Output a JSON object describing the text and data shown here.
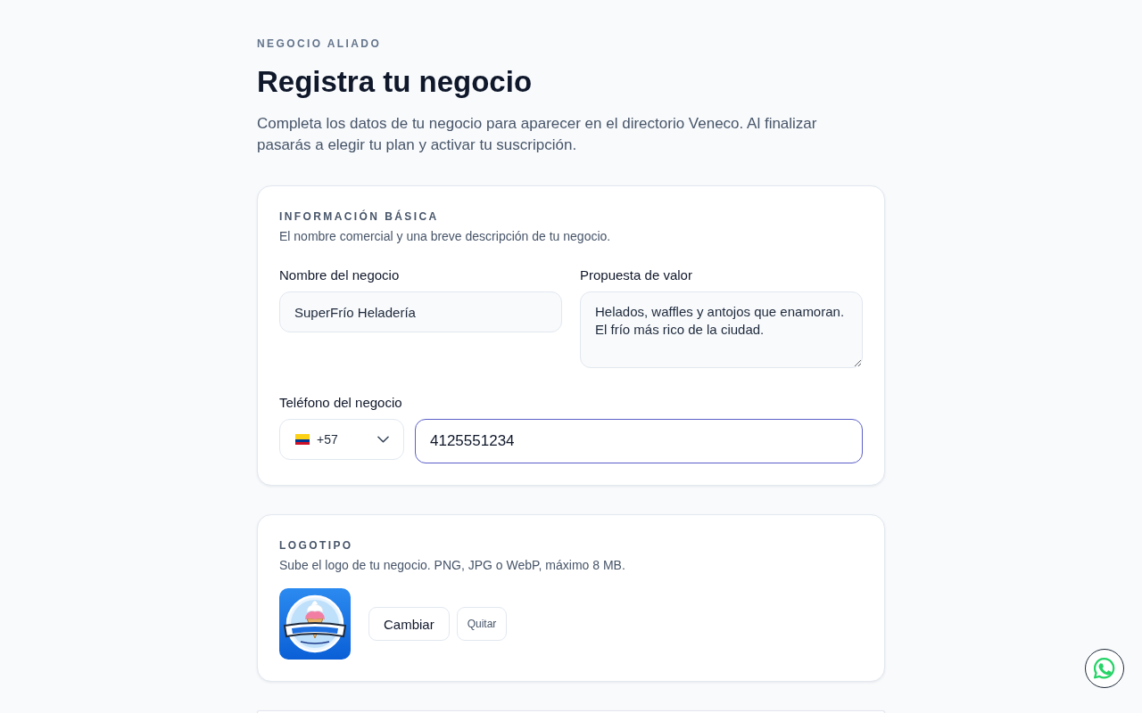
{
  "header": {
    "eyebrow": "NEGOCIO ALIADO",
    "title": "Registra tu negocio",
    "description": "Completa los datos de tu negocio para aparecer en el directorio Veneco. Al finalizar pasarás a elegir tu plan y activar tu suscripción."
  },
  "sections": [
    {
      "kind": "form",
      "title": "INFORMACIÓN BÁSICA",
      "subtitle": "El nombre comercial y una breve descripción de tu negocio.",
      "fields": [
        {
          "kind": "text",
          "label": "Nombre del negocio",
          "value": "SuperFrío Heladería",
          "focused": false
        },
        {
          "kind": "textarea",
          "label": "Propuesta de valor",
          "value": "Helados, waffles y antojos que enamoran. El frío más rico de la ciudad.",
          "focused": false
        },
        {
          "kind": "phone",
          "label": "Teléfono del negocio",
          "country_code": "+57",
          "value": "4125551234",
          "focused": true
        }
      ]
    },
    {
      "kind": "logo",
      "title": "LOGOTIPO",
      "subtitle": "Sube el logo de tu negocio. PNG, JPG o WebP, máximo 8 MB.",
      "buttons": [
        {
          "kind": "primary",
          "label": "Cambiar"
        },
        {
          "kind": "secondary",
          "label": "Quitar"
        }
      ]
    },
    {
      "kind": "cut_off"
    }
  ]
}
